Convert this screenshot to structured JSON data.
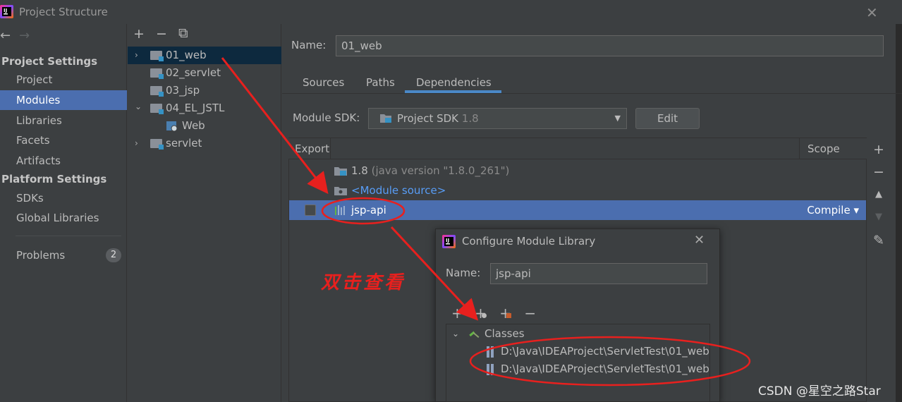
{
  "window": {
    "title": "Project Structure",
    "close_glyph": "✕"
  },
  "nav": {
    "back": "←",
    "forward": "→"
  },
  "sidebar": {
    "project_settings_header": "Project Settings",
    "platform_settings_header": "Platform Settings",
    "items": [
      {
        "label": "Project"
      },
      {
        "label": "Modules",
        "selected": true
      },
      {
        "label": "Libraries"
      },
      {
        "label": "Facets"
      },
      {
        "label": "Artifacts"
      },
      {
        "label": "SDKs"
      },
      {
        "label": "Global Libraries"
      },
      {
        "label": "Problems"
      }
    ],
    "problems_count": "2"
  },
  "modules_toolbar": {
    "add": "+",
    "remove": "−",
    "copy": "⧉"
  },
  "module_tree": [
    {
      "label": "01_web",
      "selected": true,
      "chevron": "›"
    },
    {
      "label": "02_servlet"
    },
    {
      "label": "03_jsp"
    },
    {
      "label": "04_EL_JSTL",
      "chevron": "⌄"
    },
    {
      "label": "Web"
    },
    {
      "label": "servlet",
      "chevron": "›"
    }
  ],
  "main": {
    "name_label": "Name:",
    "name_value": "01_web",
    "tabs": [
      {
        "label": "Sources"
      },
      {
        "label": "Paths"
      },
      {
        "label": "Dependencies",
        "active": true
      }
    ],
    "module_sdk_label": "Module SDK:",
    "module_sdk_value": "Project SDK",
    "module_sdk_version": "1.8",
    "edit_button": "Edit",
    "table": {
      "col_export": "Export",
      "col_scope": "Scope",
      "rows": [
        {
          "name": "1.8",
          "detail": "(java version \"1.8.0_261\")"
        },
        {
          "name": "<Module source>"
        },
        {
          "name": "jsp-api",
          "scope": "Compile",
          "selected": true
        }
      ]
    },
    "side_tools": {
      "add": "+",
      "remove": "−",
      "up": "▲",
      "down": "▼",
      "edit": "✎"
    }
  },
  "dialog": {
    "title": "Configure Module Library",
    "close": "✕",
    "name_label": "Name:",
    "name_value": "jsp-api",
    "tools": [
      "+",
      "+",
      "+",
      "−"
    ],
    "tree": {
      "root_label": "Classes",
      "items": [
        "D:\\Java\\IDEAProject\\ServletTest\\01_web\\",
        "D:\\Java\\IDEAProject\\ServletTest\\01_web\\"
      ]
    }
  },
  "annotation_text": "双击查看",
  "watermark": "CSDN @星空之路Star",
  "colors": {
    "background": "#3c3f41",
    "selection": "#4b6eaf",
    "tree_selection": "#0d293e",
    "accent_tab": "#4a88c7",
    "link": "#589df6",
    "annotation_red": "#e8201e"
  }
}
